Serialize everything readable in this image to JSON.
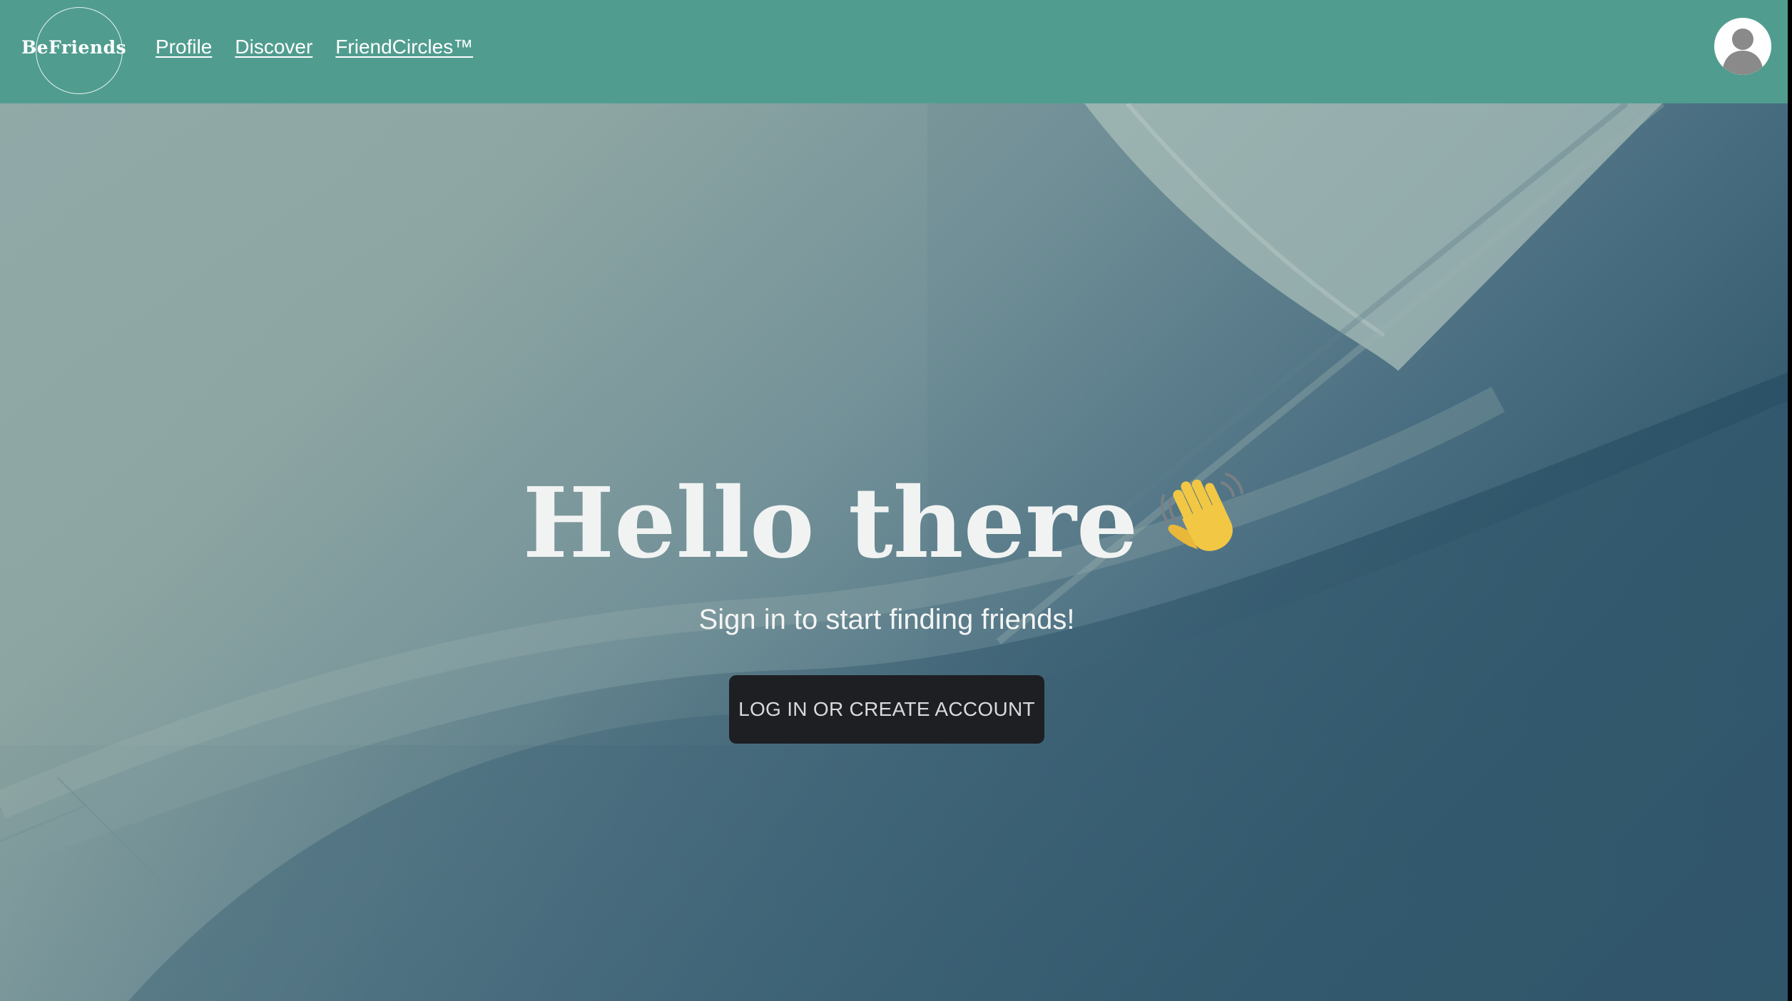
{
  "brand": {
    "logo_text": "BeFriends"
  },
  "nav": {
    "items": [
      {
        "label": "Profile"
      },
      {
        "label": "Discover"
      },
      {
        "label": "FriendCircles™"
      }
    ]
  },
  "user_menu": {
    "icon": "avatar-icon"
  },
  "hero": {
    "headline": "Hello there",
    "headline_emoji": "waving-hand-icon",
    "subtitle": "Sign in to start finding friends!",
    "cta_label": "LOG IN OR CREATE ACCOUNT"
  },
  "colors": {
    "topbar": "#509d8f",
    "button_bg": "#1d1f22",
    "hero_light": "#8aa3a3",
    "hero_dark": "#2d5166"
  }
}
